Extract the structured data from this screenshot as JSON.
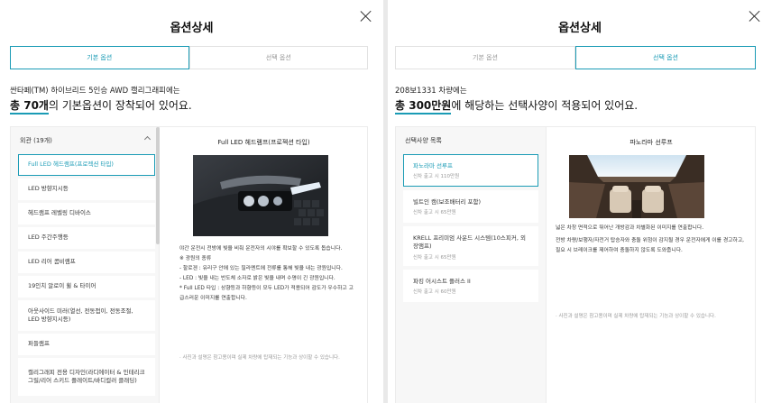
{
  "left": {
    "title": "옵션상세",
    "tabs": [
      {
        "label": "기본 옵션",
        "active": true
      },
      {
        "label": "선택 옵션",
        "active": false
      }
    ],
    "summary_line1": "싼타페(TM) 하이브리드 5인승 AWD 캘리그래피에는",
    "summary_bold": "총 70개",
    "summary_rest": "의 기본옵션이 장착되어 있어요.",
    "list_header": "외관 (19개)",
    "items": [
      "Full LED 헤드램프(프로젝션 타입)",
      "LED 방향지시등",
      "헤드램프 레벨링 디바이스",
      "LED 주간주행등",
      "LED 리어 콤비램프",
      "19인치 알로이 휠 & 타이어",
      "아웃사이드 미러(열선, 전동접이, 전동조절, LED 방향지시등)",
      "퍼들램프",
      "캘리그래피 전용 디자인(라디에이터 & 인테리크 그릴/리어 스키드 플레이트/바디컬러 클래딩)"
    ],
    "detail_title": "Full LED 헤드램프(프로젝션 타입)",
    "detail_paragraphs": [
      "야간 운전시 전방에 빛을 비춰 운전자의 시야를 확보할 수 있도록 돕습니다.",
      "※ 광원의 종류",
      "- 할로겐 : 유리구 안에 있는 필라멘트에 전류를 통해 빛을 내는 광원입니다.",
      "- LED : 빛을 내는 반도체 소자로 밝은 빛을 내며 수명이 긴 광원입니다.",
      "* Full LED 타입 : 상향등과 하향등이 모두 LED가 적용되어 감도가 우수하고 고급스러운 이미지를 연출합니다."
    ],
    "detail_note": "· 사진과 설명은 참고용이며 실제 차량에 탑재되는 기능과 상이할 수 있습니다."
  },
  "right": {
    "title": "옵션상세",
    "tabs": [
      {
        "label": "기본 옵션",
        "active": false
      },
      {
        "label": "선택 옵션",
        "active": true
      }
    ],
    "summary_line1": "208보1331 차량에는",
    "summary_bold": "총 300만원",
    "summary_rest": "에 해당하는 선택사양이 적용되어 있어요.",
    "list_header": "선택사양 목록",
    "items": [
      {
        "name": "파노라마 선루프",
        "sub": "신차 출고 시 110만원"
      },
      {
        "name": "빌트인 캠(보조배터리 포함)",
        "sub": "신차 출고 시 65만원"
      },
      {
        "name": "KRELL 프리미엄 사운드 시스템(10스피커, 외장앰프)",
        "sub": "신차 출고 시 65만원"
      },
      {
        "name": "파킹 어시스트 플러스 II",
        "sub": "신차 출고 시 60만원"
      }
    ],
    "detail_title": "파노라마 선루프",
    "detail_paragraphs": [
      "넓은 차창 면적으로 뛰어난 개방감과 차별화된 이미지를 연출합니다.",
      "전방 차량/보행자/자전거 탑승자와 충돌 위험이 감지될 경우 운전자에게 이를 경고하고, 필요 시 브레이크를 제어하여 충돌하지 않도록 도와줍니다."
    ],
    "detail_note": "· 사진과 설명은 참고용이며 실제 차량에 탑재되는 기능과 상이할 수 있습니다."
  }
}
